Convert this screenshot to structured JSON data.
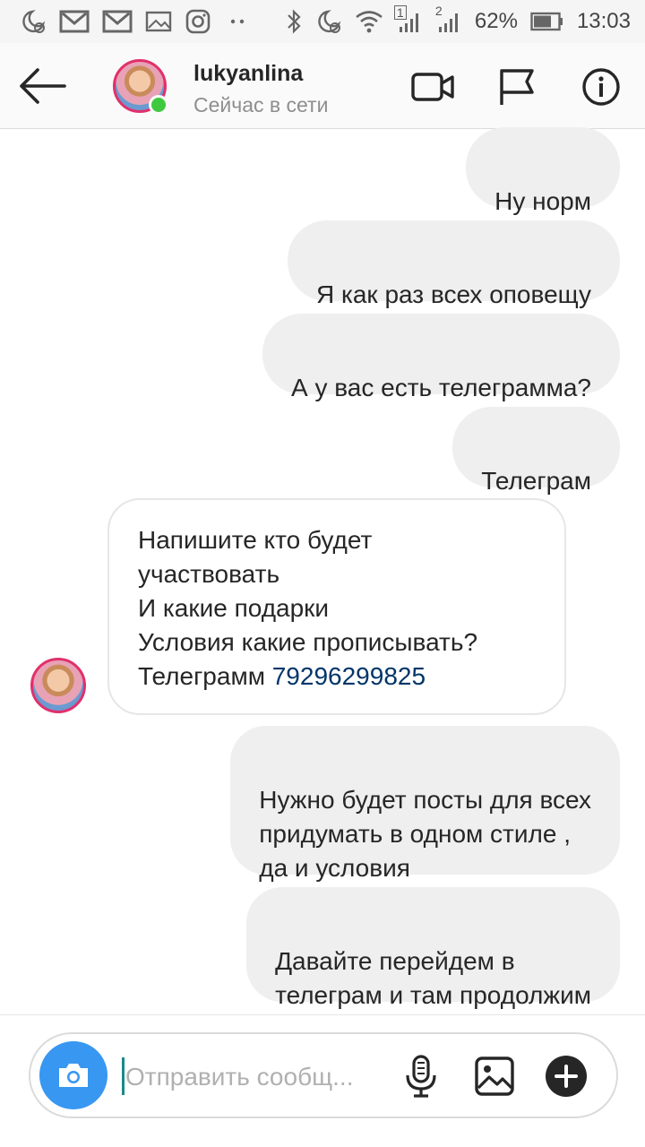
{
  "status_bar": {
    "battery": "62%",
    "time": "13:03",
    "sim1": "1",
    "sim2": "2",
    "icons_left": [
      "moon-alarm-icon",
      "gmail-icon",
      "gmail-icon",
      "gallery-icon",
      "instagram-icon",
      "more-dots-icon"
    ],
    "icons_right": [
      "bluetooth-icon",
      "moon-alarm-icon",
      "wifi-icon",
      "signal-icon",
      "signal-icon",
      "battery-icon"
    ]
  },
  "header": {
    "username": "lukyanlina",
    "status": "Сейчас в сети",
    "icons": [
      "back-arrow-icon",
      "video-call-icon",
      "flag-icon",
      "info-icon"
    ]
  },
  "messages": [
    {
      "from": "me",
      "text": "Ну норм"
    },
    {
      "from": "me",
      "text": "Я как раз всех оповещу"
    },
    {
      "from": "me",
      "text": "А у вас есть телеграмма?"
    },
    {
      "from": "me",
      "text": "Телеграм"
    },
    {
      "from": "them",
      "text": "Напишите кто будет\nучаствовать\nИ какие подарки\nУсловия какие прописывать?\nТелеграмм ",
      "phone": "79296299825"
    },
    {
      "from": "me",
      "text": "Нужно будет посты для всех\nпридумать в одном стиле ,\nда и условия"
    },
    {
      "from": "me",
      "text": "Давайте перейдем в\nтелеграм и там продолжим"
    }
  ],
  "composer": {
    "placeholder": "Отправить сообщ...",
    "icons": [
      "camera-icon",
      "microphone-icon",
      "image-icon",
      "plus-icon"
    ]
  },
  "colors": {
    "accent": "#3897f0",
    "online": "#3ec93e",
    "my_bubble": "#efefef",
    "link": "#003569"
  }
}
